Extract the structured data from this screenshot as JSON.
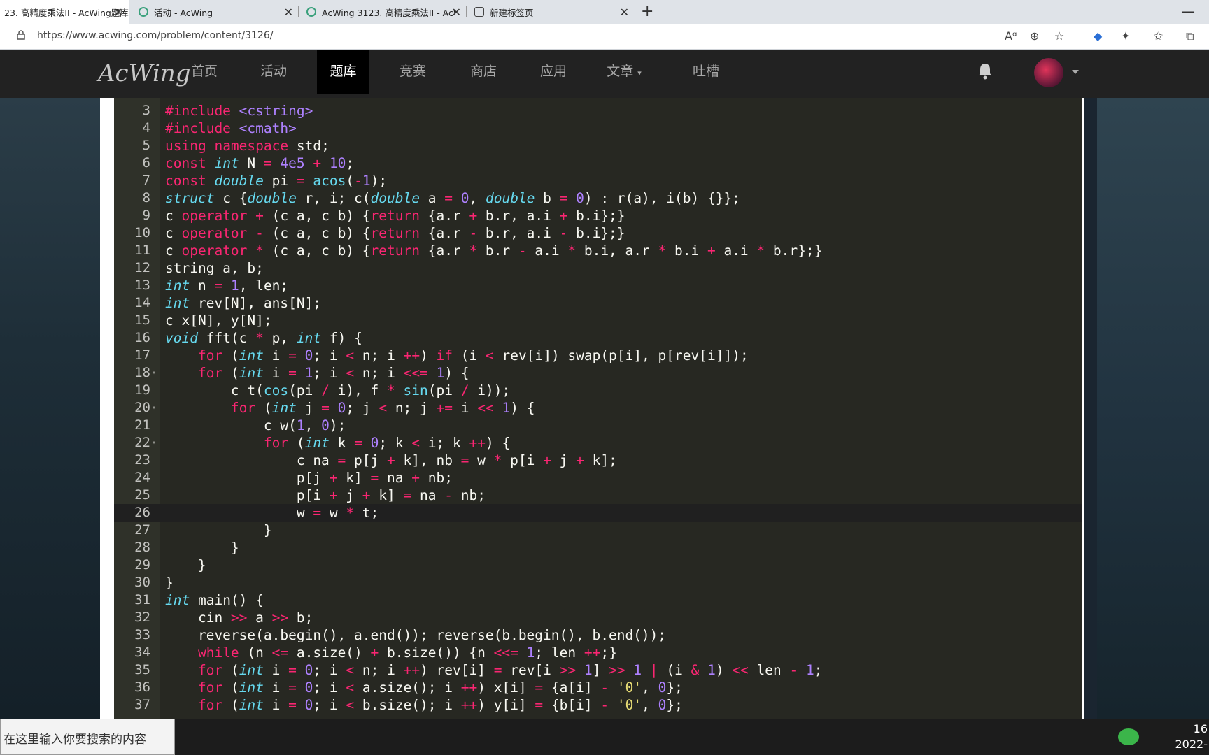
{
  "browser": {
    "tabs": [
      {
        "title": "23. 高精度乘法II - AcWing题库",
        "active": true
      },
      {
        "title": "活动 - AcWing",
        "active": false
      },
      {
        "title": "AcWing 3123. 高精度乘法II - AcW",
        "active": false
      },
      {
        "title": "新建标签页",
        "active": false
      }
    ],
    "new_tab": "+",
    "close": "✕",
    "url": "https://www.acwing.com/problem/content/3126/"
  },
  "site": {
    "logo": "AcWing",
    "nav": [
      "首页",
      "活动",
      "题库",
      "竞赛",
      "商店",
      "应用",
      "文章",
      "吐槽"
    ],
    "active_nav": "题库"
  },
  "editor": {
    "current_line": 26,
    "lines": [
      {
        "n": "3",
        "text": "#include <cstring>"
      },
      {
        "n": "4",
        "text": "#include <cmath>"
      },
      {
        "n": "5",
        "text": "using namespace std;"
      },
      {
        "n": "6",
        "text": "const int N = 4e5 + 10;"
      },
      {
        "n": "7",
        "text": "const double pi = acos(-1);"
      },
      {
        "n": "8",
        "text": "struct c {double r, i; c(double a = 0, double b = 0) : r(a), i(b) {}};"
      },
      {
        "n": "9",
        "text": "c operator + (c a, c b) {return {a.r + b.r, a.i + b.i};}"
      },
      {
        "n": "10",
        "text": "c operator - (c a, c b) {return {a.r - b.r, a.i - b.i};}"
      },
      {
        "n": "11",
        "text": "c operator * (c a, c b) {return {a.r * b.r - a.i * b.i, a.r * b.i + a.i * b.r};}"
      },
      {
        "n": "12",
        "text": "string a, b;"
      },
      {
        "n": "13",
        "text": "int n = 1, len;"
      },
      {
        "n": "14",
        "text": "int rev[N], ans[N];"
      },
      {
        "n": "15",
        "text": "c x[N], y[N];"
      },
      {
        "n": "16",
        "text": "void fft(c * p, int f) {"
      },
      {
        "n": "17",
        "text": "    for (int i = 0; i < n; i ++) if (i < rev[i]) swap(p[i], p[rev[i]]);"
      },
      {
        "n": "18",
        "text": "    for (int i = 1; i < n; i <<= 1) {"
      },
      {
        "n": "19",
        "text": "        c t(cos(pi / i), f * sin(pi / i));"
      },
      {
        "n": "20",
        "text": "        for (int j = 0; j < n; j += i << 1) {"
      },
      {
        "n": "21",
        "text": "            c w(1, 0);"
      },
      {
        "n": "22",
        "text": "            for (int k = 0; k < i; k ++) {"
      },
      {
        "n": "23",
        "text": "                c na = p[j + k], nb = w * p[i + j + k];"
      },
      {
        "n": "24",
        "text": "                p[j + k] = na + nb;"
      },
      {
        "n": "25",
        "text": "                p[i + j + k] = na - nb;"
      },
      {
        "n": "26",
        "text": "                w = w * t;"
      },
      {
        "n": "27",
        "text": "            }"
      },
      {
        "n": "28",
        "text": "        }"
      },
      {
        "n": "29",
        "text": "    }"
      },
      {
        "n": "30",
        "text": "}"
      },
      {
        "n": "31",
        "text": "int main() {"
      },
      {
        "n": "32",
        "text": "    cin >> a >> b;"
      },
      {
        "n": "33",
        "text": "    reverse(a.begin(), a.end()); reverse(b.begin(), b.end());"
      },
      {
        "n": "34",
        "text": "    while (n <= a.size() + b.size()) {n <<= 1; len ++;}"
      },
      {
        "n": "35",
        "text": "    for (int i = 0; i < n; i ++) rev[i] = rev[i >> 1] >> 1 | (i & 1) << len - 1;"
      },
      {
        "n": "36",
        "text": "    for (int i = 0; i < a.size(); i ++) x[i] = {a[i] - '0', 0};"
      },
      {
        "n": "37",
        "text": "    for (int i = 0; i < b.size(); i ++) y[i] = {b[i] - '0', 0};"
      }
    ],
    "fold_lines": [
      "18",
      "20",
      "22"
    ]
  },
  "taskbar": {
    "search_placeholder": "在这里输入你要搜索的内容",
    "time": "16",
    "date": "2022-"
  },
  "colors": {
    "editor_bg": "#272822",
    "keyword": "#f92672",
    "type": "#66d9ef",
    "number": "#ae81ff",
    "string": "#e6db74",
    "navbar": "#222222"
  }
}
